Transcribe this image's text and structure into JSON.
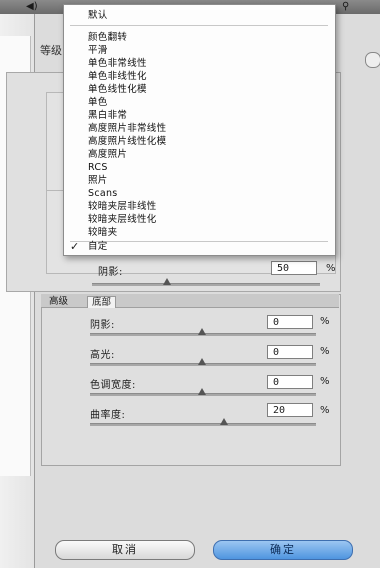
{
  "dialog": {
    "title": "等级",
    "lower_tab_active": "高级",
    "lower_tab": "底部"
  },
  "menu": {
    "items": [
      {
        "label": "默认",
        "checked": false
      },
      {
        "label": "颜色翻转",
        "checked": false
      },
      {
        "label": "平滑",
        "checked": false
      },
      {
        "label": "单色非常线性",
        "checked": false
      },
      {
        "label": "单色非线性化",
        "checked": false
      },
      {
        "label": "单色线性化模",
        "checked": false
      },
      {
        "label": "单色",
        "checked": false
      },
      {
        "label": "黑白非常",
        "checked": false
      },
      {
        "label": "高度照片非常线性",
        "checked": false
      },
      {
        "label": "高度照片线性化模",
        "checked": false
      },
      {
        "label": "高度照片",
        "checked": false
      },
      {
        "label": "RCS",
        "checked": false
      },
      {
        "label": "照片",
        "checked": false
      },
      {
        "label": "Scans",
        "checked": false
      },
      {
        "label": "较暗夹层非线性",
        "checked": false
      },
      {
        "label": "较暗夹层线性化",
        "checked": false
      },
      {
        "label": "较暗夹",
        "checked": false
      },
      {
        "label": "自定",
        "checked": true
      }
    ]
  },
  "upper": {
    "amount_label": "阴影:",
    "amount_value": "50",
    "amount_unit": "%"
  },
  "rows": [
    {
      "label": "阴影:",
      "value": "0",
      "unit": "%",
      "slider": 0.5
    },
    {
      "label": "高光:",
      "value": "0",
      "unit": "%",
      "slider": 0.5
    },
    {
      "label": "色调宽度:",
      "value": "0",
      "unit": "%",
      "slider": 0.5
    },
    {
      "label": "曲率度:",
      "value": "20",
      "unit": "%",
      "slider": 0.6
    }
  ],
  "buttons": {
    "cancel": "取消",
    "ok": "确定"
  },
  "colors": {
    "ok_button": "#4f95e0",
    "dialog_bg": "#dcdcdc"
  }
}
